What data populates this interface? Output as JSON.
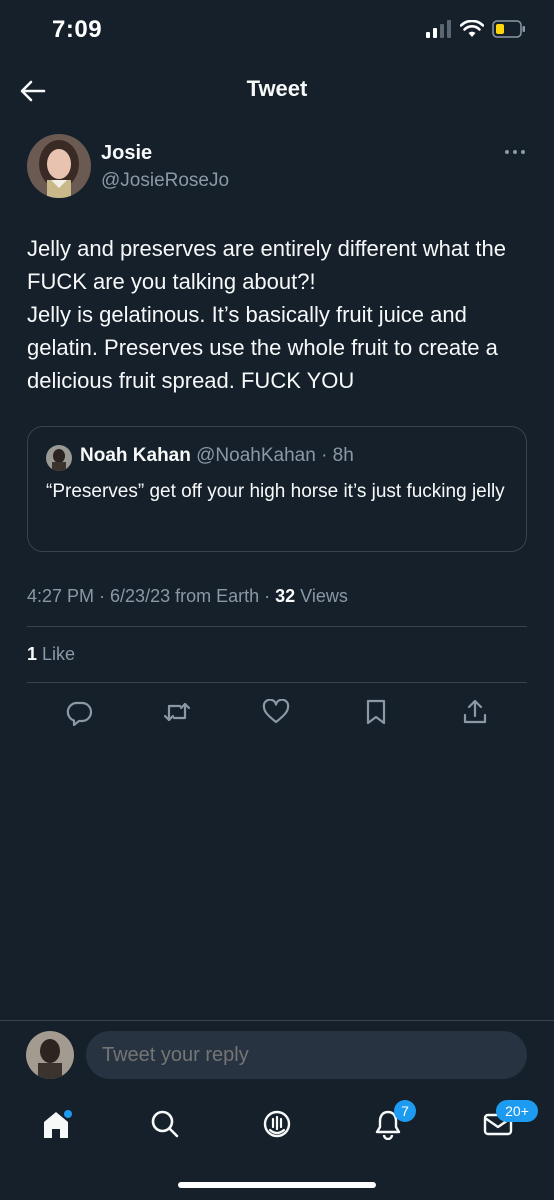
{
  "status_bar": {
    "time": "7:09"
  },
  "header": {
    "title": "Tweet"
  },
  "tweet": {
    "author_name": "Josie",
    "author_handle": "@JosieRoseJo",
    "text_lines": [
      "Jelly and preserves are entirely different what the FUCK are you talking about?!",
      "Jelly is gelatinous. It’s basically fruit juice and gelatin. Preserves use the whole fruit to create a delicious fruit spread. FUCK YOU"
    ],
    "quote": {
      "author_name": "Noah Kahan",
      "author_meta": " @NoahKahan · 8h",
      "text": "“Preserves” get off your high horse it’s just fucking jelly"
    },
    "meta": {
      "time_date_source": "4:27 PM · 6/23/23 from Earth · ",
      "views_count": "32",
      "views_label": " Views"
    },
    "likes": {
      "count": "1",
      "label": " Like"
    }
  },
  "reply_bar": {
    "placeholder": "Tweet your reply"
  },
  "tab_bar": {
    "notifications_badge": "7",
    "messages_badge": "20+"
  },
  "colors": {
    "background": "#15202b",
    "accent": "#1d9bf0",
    "secondary_text": "#8b98a5",
    "border": "#38444d"
  }
}
